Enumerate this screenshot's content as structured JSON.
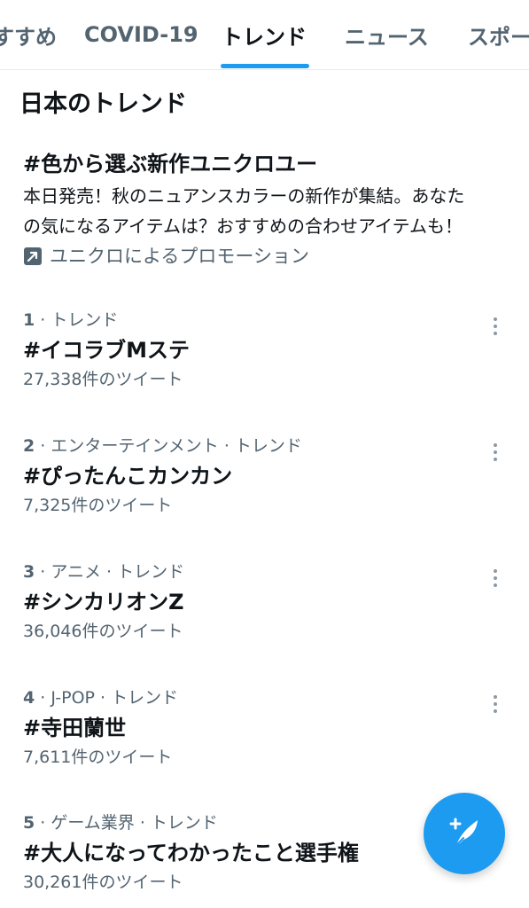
{
  "tabs": [
    {
      "label": "すすめ"
    },
    {
      "label": "COVID-19"
    },
    {
      "label": "トレンド"
    },
    {
      "label": "ニュース"
    },
    {
      "label": "スポー"
    }
  ],
  "active_tab": "トレンド",
  "section": {
    "title": "日本のトレンド"
  },
  "promo": {
    "title": "#色から選ぶ新作ユニクロユー",
    "desc_line1": "本日発売！秋のニュアンスカラーの新作が集結。あなた",
    "desc_line2": "の気になるアイテムは？おすすめの合わせアイテムも！",
    "by": "ユニクロによるプロモーション",
    "icon": "promoted-arrow-icon"
  },
  "trends": [
    {
      "rank": "1",
      "context": "· トレンド",
      "name": "#イコラブMステ",
      "count": "27,338件のツイート"
    },
    {
      "rank": "2",
      "context": "· エンターテインメント · トレンド",
      "name": "#ぴったんこカンカン",
      "count": "7,325件のツイート"
    },
    {
      "rank": "3",
      "context": "· アニメ · トレンド",
      "name": "#シンカリオンZ",
      "count": "36,046件のツイート"
    },
    {
      "rank": "4",
      "context": "· J-POP · トレンド",
      "name": "#寺田蘭世",
      "count": "7,611件のツイート"
    },
    {
      "rank": "5",
      "context": "· ゲーム業界 · トレンド",
      "name": "#大人になってわかったこと選手権",
      "count": "30,261件のツイート"
    }
  ],
  "colors": {
    "accent": "#1d9bf0",
    "text": "#0f1419",
    "secondary": "#536471"
  },
  "fab": {
    "icon": "compose-tweet-icon"
  }
}
